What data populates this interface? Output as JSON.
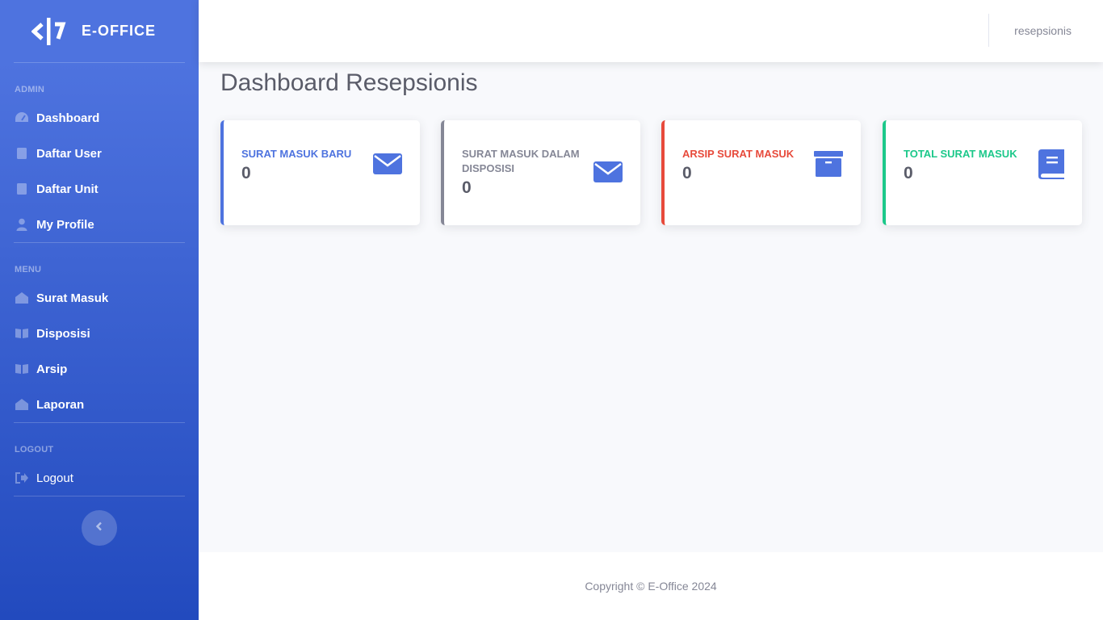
{
  "brand": {
    "name": "E-OFFICE"
  },
  "sidebar": {
    "sections": [
      {
        "heading": "ADMIN",
        "items": [
          {
            "label": "Dashboard",
            "icon": "tachometer-icon"
          },
          {
            "label": "Daftar User",
            "icon": "book-icon"
          },
          {
            "label": "Daftar Unit",
            "icon": "book-icon"
          },
          {
            "label": "My Profile",
            "icon": "user-icon"
          }
        ]
      },
      {
        "heading": "MENU",
        "items": [
          {
            "label": "Surat Masuk",
            "icon": "envelope-open-icon"
          },
          {
            "label": "Disposisi",
            "icon": "book-open-icon"
          },
          {
            "label": "Arsip",
            "icon": "book-open-icon"
          },
          {
            "label": "Laporan",
            "icon": "envelope-open-icon"
          }
        ]
      },
      {
        "heading": "LOGOUT",
        "items": [
          {
            "label": "Logout",
            "icon": "sign-out-icon"
          }
        ]
      }
    ]
  },
  "topbar": {
    "user": "resepsionis"
  },
  "main": {
    "title": "Dashboard Resepsionis",
    "cards": [
      {
        "label": "SURAT MASUK BARU",
        "value": "0",
        "color": "#4e73df",
        "icon": "envelope-icon"
      },
      {
        "label": "SURAT MASUK DALAM DISPOSISI",
        "value": "0",
        "color": "#858796",
        "icon": "envelope-icon"
      },
      {
        "label": "ARSIP SURAT MASUK",
        "value": "0",
        "color": "#e74a3b",
        "icon": "archive-icon"
      },
      {
        "label": "TOTAL SURAT MASUK",
        "value": "0",
        "color": "#1cc88a",
        "icon": "book-icon"
      }
    ]
  },
  "footer": {
    "text": "Copyright © E-Office 2024"
  },
  "colors": {
    "primary": "#4e73df",
    "primary_dark": "#224abe",
    "text": "#5a5c69",
    "muted": "#858796"
  }
}
